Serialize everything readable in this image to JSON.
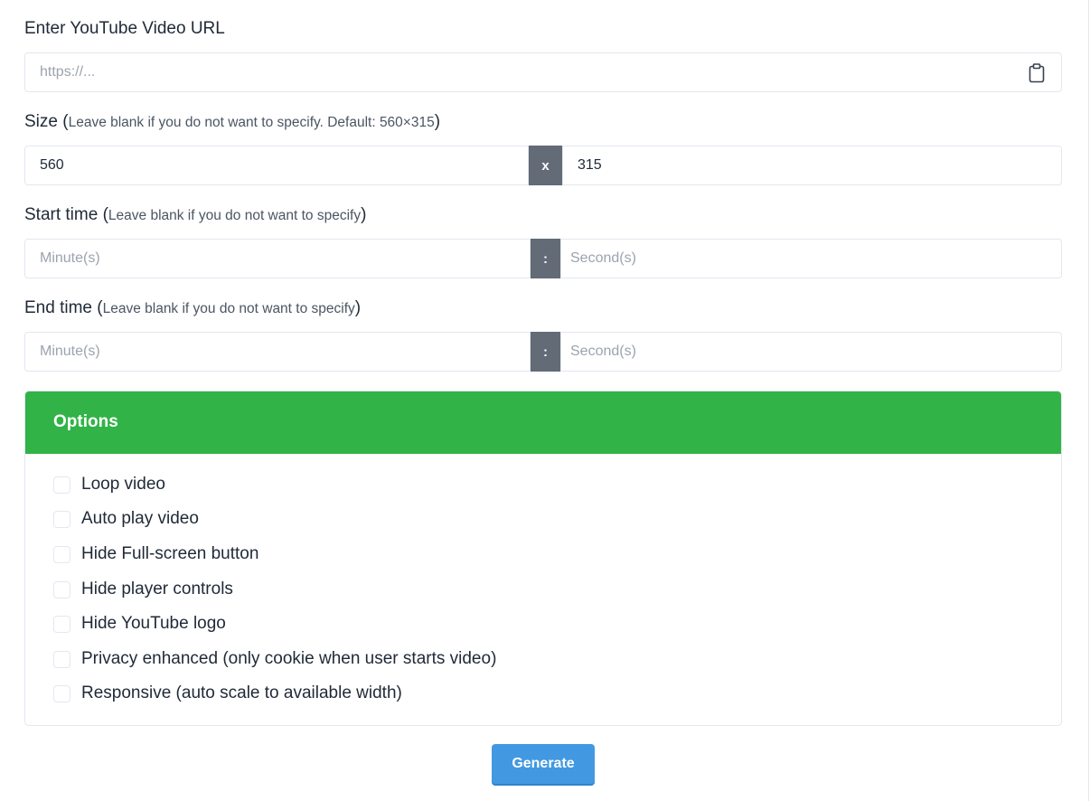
{
  "url": {
    "label": "Enter YouTube Video URL",
    "placeholder": "https://...",
    "icon": "clipboard-icon"
  },
  "size": {
    "label": "Size (",
    "hint": "Leave blank if you do not want to specify. Default: 560×315",
    "close": ")",
    "width": "560",
    "separator": "x",
    "height": "315"
  },
  "start": {
    "label": "Start time (",
    "hint": "Leave blank if you do not want to specify",
    "close": ")",
    "min_placeholder": "Minute(s)",
    "separator": ":",
    "sec_placeholder": "Second(s)"
  },
  "end": {
    "label": "End time (",
    "hint": "Leave blank if you do not want to specify",
    "close": ")",
    "min_placeholder": "Minute(s)",
    "separator": ":",
    "sec_placeholder": "Second(s)"
  },
  "options": {
    "title": "Options",
    "header_color": "#31b347",
    "items": [
      {
        "label": "Loop video",
        "checked": false
      },
      {
        "label": "Auto play video",
        "checked": false
      },
      {
        "label": "Hide Full-screen button",
        "checked": false
      },
      {
        "label": "Hide player controls",
        "checked": false
      },
      {
        "label": "Hide YouTube logo",
        "checked": false
      },
      {
        "label": "Privacy enhanced (only cookie when user starts video)",
        "checked": false
      },
      {
        "label": "Responsive (auto scale to available width)",
        "checked": false
      }
    ]
  },
  "generate": {
    "label": "Generate",
    "color": "#4299e1"
  }
}
